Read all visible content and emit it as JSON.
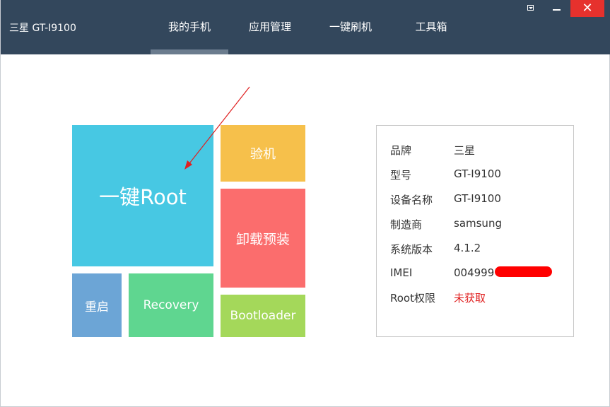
{
  "window": {
    "device_title": "三星 GT-I9100",
    "close_glyph": "✕"
  },
  "nav": {
    "tabs": [
      {
        "label": "我的手机",
        "active": true
      },
      {
        "label": "应用管理",
        "active": false
      },
      {
        "label": "一键刷机",
        "active": false
      },
      {
        "label": "工具箱",
        "active": false
      }
    ]
  },
  "tiles": {
    "root": "一键Root",
    "inspect": "验机",
    "uninstall": "卸载预装",
    "reboot": "重启",
    "recovery": "Recovery",
    "bootloader": "Bootloader"
  },
  "info": {
    "rows": [
      {
        "label": "品牌",
        "value": "三星"
      },
      {
        "label": "型号",
        "value": "GT-I9100"
      },
      {
        "label": "设备名称",
        "value": "GT-I9100"
      },
      {
        "label": "制造商",
        "value": "samsung"
      },
      {
        "label": "系统版本",
        "value": "4.1.2"
      },
      {
        "label": "IMEI",
        "value": "004999"
      },
      {
        "label": "Root权限",
        "value": "未获取"
      }
    ]
  },
  "colors": {
    "titlebar": "#33475c",
    "root_tile": "#47c8e3",
    "inspect_tile": "#f6c04b",
    "uninstall_tile": "#fb6d6d",
    "reboot_tile": "#6ca5d6",
    "recovery_tile": "#5fd690",
    "bootloader_tile": "#a4d85a",
    "warning_text": "#e02020",
    "close_button": "#e6312d"
  }
}
